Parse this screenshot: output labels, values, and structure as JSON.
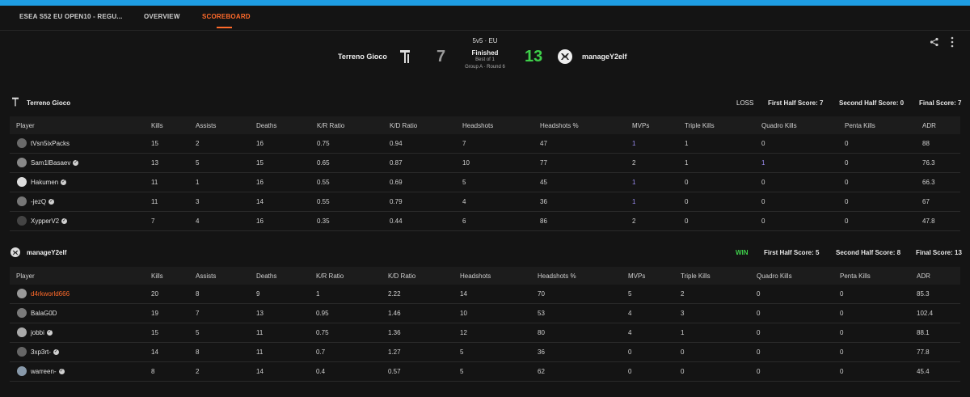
{
  "nav": {
    "tabs": [
      {
        "label": "ESEA S52 EU OPEN10 - REGU..."
      },
      {
        "label": "OVERVIEW"
      },
      {
        "label": "SCOREBOARD"
      }
    ]
  },
  "match": {
    "team1": "Terreno Gioco",
    "team2": "manageY2elf",
    "score1": "7",
    "score2": "13",
    "format": "5v5 · EU",
    "status": "Finished",
    "best_of": "Best of 1",
    "group": "Group A · Round 6"
  },
  "colors": {
    "accent": "#ff6a2a",
    "win": "#3ecf4a",
    "topbar": "#1e9de3",
    "purple_stat": "#9a8cf0"
  },
  "icons": {
    "share": "share-icon",
    "more": "more-vertical-icon",
    "verified": "verified-check-icon"
  },
  "headers": [
    "Player",
    "Kills",
    "Assists",
    "Deaths",
    "K/R Ratio",
    "K/D Ratio",
    "Headshots",
    "Headshots %",
    "MVPs",
    "Triple Kills",
    "Quadro Kills",
    "Penta Kills",
    "ADR"
  ],
  "team1": {
    "name": "Terreno Gioco",
    "result": "LOSS",
    "first_half": "First Half Score: 7",
    "second_half": "Second Half Score: 0",
    "final": "Final Score: 7",
    "players": [
      {
        "name": "tVsn5ixPacks",
        "verified": false,
        "stats": [
          "15",
          "2",
          "16",
          "0.75",
          "0.94",
          "7",
          "47",
          "1",
          "1",
          "0",
          "0",
          "88"
        ]
      },
      {
        "name": "Sam1lBasaev",
        "verified": true,
        "stats": [
          "13",
          "5",
          "15",
          "0.65",
          "0.87",
          "10",
          "77",
          "2",
          "1",
          "1",
          "0",
          "76.3"
        ]
      },
      {
        "name": "Hakumen",
        "verified": true,
        "stats": [
          "11",
          "1",
          "16",
          "0.55",
          "0.69",
          "5",
          "45",
          "1",
          "0",
          "0",
          "0",
          "66.3"
        ]
      },
      {
        "name": "-jezQ",
        "verified": true,
        "stats": [
          "11",
          "3",
          "14",
          "0.55",
          "0.79",
          "4",
          "36",
          "1",
          "0",
          "0",
          "0",
          "67"
        ]
      },
      {
        "name": "XypperV2",
        "verified": true,
        "stats": [
          "7",
          "4",
          "16",
          "0.35",
          "0.44",
          "6",
          "86",
          "2",
          "0",
          "0",
          "0",
          "47.8"
        ]
      }
    ]
  },
  "team2": {
    "name": "manageY2elf",
    "result": "WIN",
    "first_half": "First Half Score: 5",
    "second_half": "Second Half Score: 8",
    "final": "Final Score: 13",
    "players": [
      {
        "name": "d4rkworld666",
        "verified": false,
        "stats": [
          "20",
          "8",
          "9",
          "1",
          "2.22",
          "14",
          "70",
          "5",
          "2",
          "0",
          "0",
          "85.3"
        ]
      },
      {
        "name": "BalaG0D",
        "verified": false,
        "stats": [
          "19",
          "7",
          "13",
          "0.95",
          "1.46",
          "10",
          "53",
          "4",
          "3",
          "0",
          "0",
          "102.4"
        ]
      },
      {
        "name": "jobbi",
        "verified": true,
        "stats": [
          "15",
          "5",
          "11",
          "0.75",
          "1.36",
          "12",
          "80",
          "4",
          "1",
          "0",
          "0",
          "88.1"
        ]
      },
      {
        "name": "3xp3rt-",
        "verified": true,
        "stats": [
          "14",
          "8",
          "11",
          "0.7",
          "1.27",
          "5",
          "36",
          "0",
          "0",
          "0",
          "0",
          "77.8"
        ]
      },
      {
        "name": "warreen-",
        "verified": true,
        "stats": [
          "8",
          "2",
          "14",
          "0.4",
          "0.57",
          "5",
          "62",
          "0",
          "0",
          "0",
          "0",
          "45.4"
        ]
      }
    ]
  }
}
